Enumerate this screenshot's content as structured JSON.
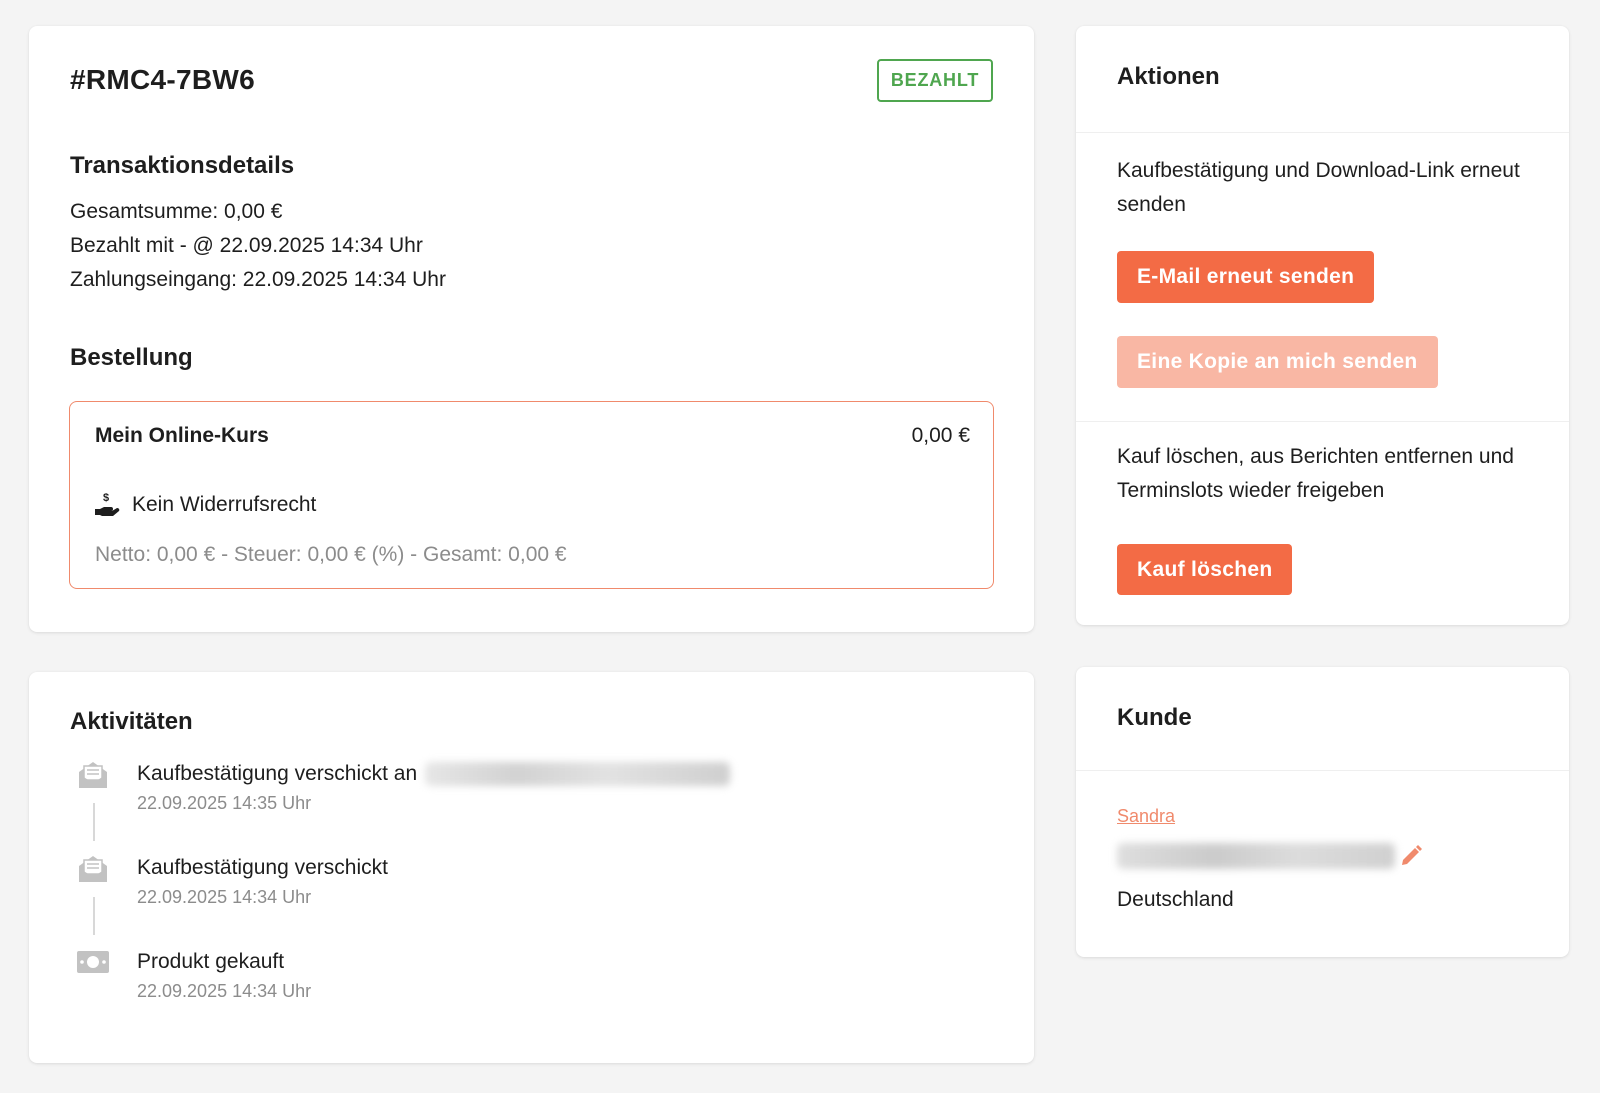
{
  "order": {
    "id": "#RMC4-7BW6",
    "status": "BEZAHLT",
    "status_color": "#4fa64f",
    "transaction_heading": "Transaktionsdetails",
    "total_line": "Gesamtsumme: 0,00 €",
    "paid_with_line": "Bezahlt mit - @ 22.09.2025 14:34 Uhr",
    "payment_received_line": "Zahlungseingang: 22.09.2025 14:34 Uhr",
    "order_heading": "Bestellung",
    "item": {
      "name": "Mein Online-Kurs",
      "price": "0,00 €",
      "withdrawal": "Kein Widerrufsrecht",
      "withdrawal_icon": "hand-money-icon",
      "breakdown": "Netto: 0,00 € - Steuer: 0,00 € (%) - Gesamt: 0,00 €"
    }
  },
  "activities": {
    "heading": "Aktivitäten",
    "items": [
      {
        "icon": "envelope-open-icon",
        "title": "Kaufbestätigung verschickt an",
        "time": "22.09.2025 14:35 Uhr"
      },
      {
        "icon": "envelope-open-icon",
        "title": "Kaufbestätigung verschickt",
        "time": "22.09.2025 14:34 Uhr"
      },
      {
        "icon": "banknote-icon",
        "title": "Produkt gekauft",
        "time": "22.09.2025 14:34 Uhr"
      }
    ]
  },
  "actions": {
    "heading": "Aktionen",
    "resend_text": "Kaufbestätigung und Download-Link erneut senden",
    "resend_button": "E-Mail erneut senden",
    "copy_button": "Eine Kopie an mich senden",
    "delete_text": "Kauf löschen, aus Berichten entfernen und Terminslots wieder freigeben",
    "delete_button": "Kauf löschen",
    "accent_color": "#f36b45"
  },
  "customer": {
    "heading": "Kunde",
    "name": "Sandra",
    "country": "Deutschland"
  }
}
